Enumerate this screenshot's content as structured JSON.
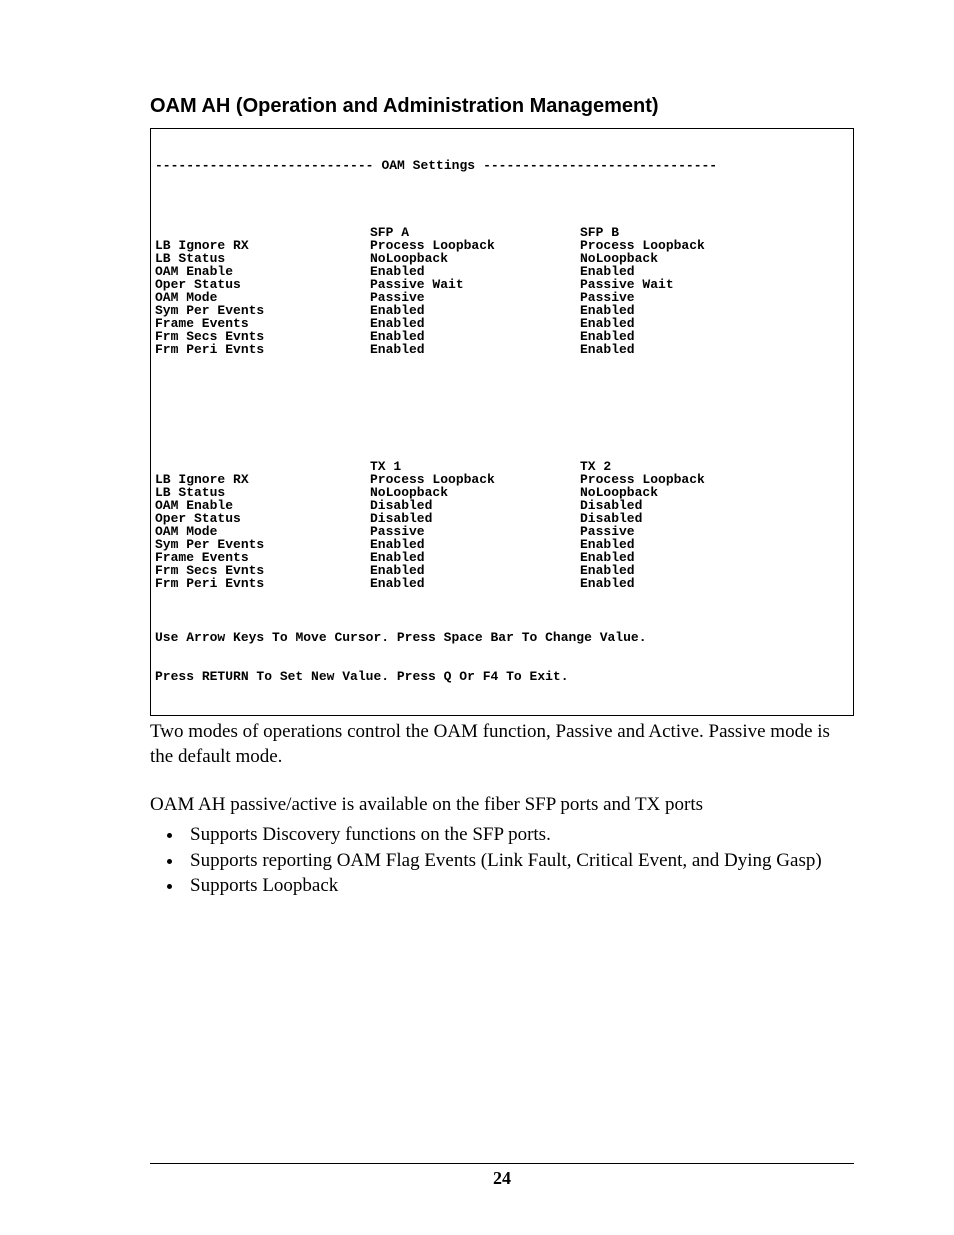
{
  "section_title": "OAM AH (Operation and Administration Management)",
  "terminal": {
    "title": "OAM Settings",
    "block1": {
      "colA_header": "SFP A",
      "colB_header": "SFP B",
      "rows": [
        {
          "label": "LB Ignore RX",
          "a": "Process Loopback",
          "b": "Process Loopback"
        },
        {
          "label": "LB Status",
          "a": "NoLoopback",
          "b": "NoLoopback"
        },
        {
          "label": "OAM Enable",
          "a": "Enabled",
          "b": "Enabled"
        },
        {
          "label": "Oper Status",
          "a": "Passive Wait",
          "b": "Passive Wait"
        },
        {
          "label": "OAM Mode",
          "a": "Passive",
          "b": "Passive"
        },
        {
          "label": "Sym Per Events",
          "a": "Enabled",
          "b": "Enabled"
        },
        {
          "label": "Frame Events",
          "a": "Enabled",
          "b": "Enabled"
        },
        {
          "label": "Frm Secs Evnts",
          "a": "Enabled",
          "b": "Enabled"
        },
        {
          "label": "Frm Peri Evnts",
          "a": "Enabled",
          "b": "Enabled"
        }
      ]
    },
    "block2": {
      "colA_header": "TX 1",
      "colB_header": "TX 2",
      "rows": [
        {
          "label": "LB Ignore RX",
          "a": "Process Loopback",
          "b": "Process Loopback"
        },
        {
          "label": "LB Status",
          "a": "NoLoopback",
          "b": "NoLoopback"
        },
        {
          "label": "OAM Enable",
          "a": "Disabled",
          "b": "Disabled"
        },
        {
          "label": "Oper Status",
          "a": "Disabled",
          "b": "Disabled"
        },
        {
          "label": "OAM Mode",
          "a": "Passive",
          "b": "Passive"
        },
        {
          "label": "Sym Per Events",
          "a": "Enabled",
          "b": "Enabled"
        },
        {
          "label": "Frame Events",
          "a": "Enabled",
          "b": "Enabled"
        },
        {
          "label": "Frm Secs Evnts",
          "a": "Enabled",
          "b": "Enabled"
        },
        {
          "label": "Frm Peri Evnts",
          "a": "Enabled",
          "b": "Enabled"
        }
      ]
    },
    "hint1_pre": "Use ",
    "hint1_b1": "Arrow Keys",
    "hint1_mid": " To Move Cursor. Press ",
    "hint1_b2": "Space Bar",
    "hint1_post": " To Change Value.",
    "hint2_pre": "Press ",
    "hint2_b1": "RETURN",
    "hint2_mid": " To Set New Value. Press ",
    "hint2_b2": "Q",
    "hint2_mid2": " Or ",
    "hint2_b3": "F4",
    "hint2_post": " To Exit."
  },
  "para1": "Two modes of operations control the OAM function, Passive and Active.  Passive mode is the default mode.",
  "para2": "OAM AH passive/active is available on the fiber SFP ports and TX ports",
  "bullets": [
    "Supports Discovery functions on the SFP ports.",
    "Supports reporting OAM Flag Events (Link Fault, Critical Event, and Dying Gasp)",
    "Supports Loopback"
  ],
  "page_number": "24"
}
